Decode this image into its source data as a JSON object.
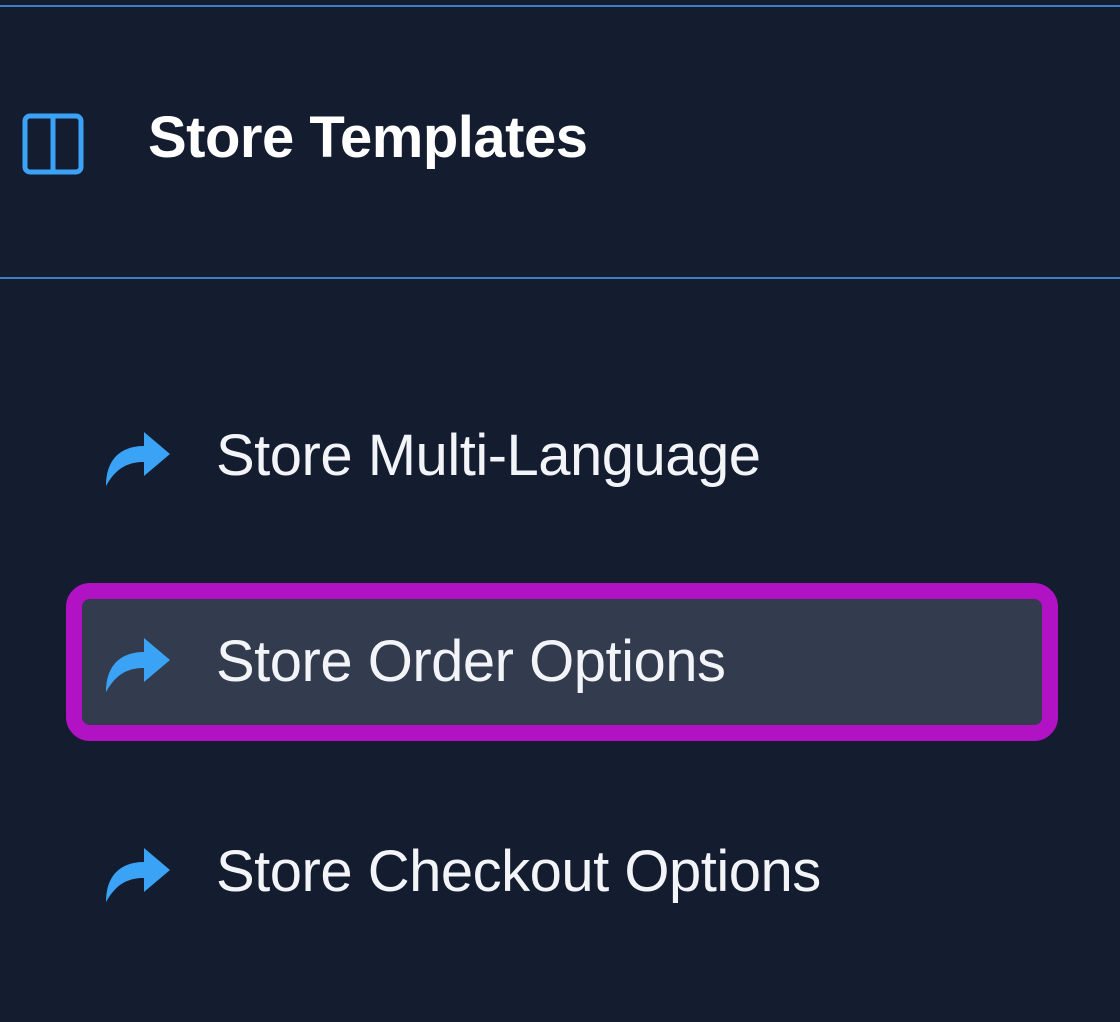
{
  "section": {
    "title": "Store Templates",
    "icon": "columns-layout-icon"
  },
  "nav": {
    "items": [
      {
        "label": "Store Multi-Language",
        "icon": "share-arrow-icon",
        "selected": false
      },
      {
        "label": "Store Order Options",
        "icon": "share-arrow-icon",
        "selected": true
      },
      {
        "label": "Store Checkout Options",
        "icon": "share-arrow-icon",
        "selected": false
      }
    ]
  },
  "colors": {
    "background": "#141c2f",
    "divider": "#3d7fc4",
    "icon_accent": "#3aa3f5",
    "selected_background": "#333b4f",
    "highlight_border": "#b012c4",
    "text": "#ffffff"
  }
}
